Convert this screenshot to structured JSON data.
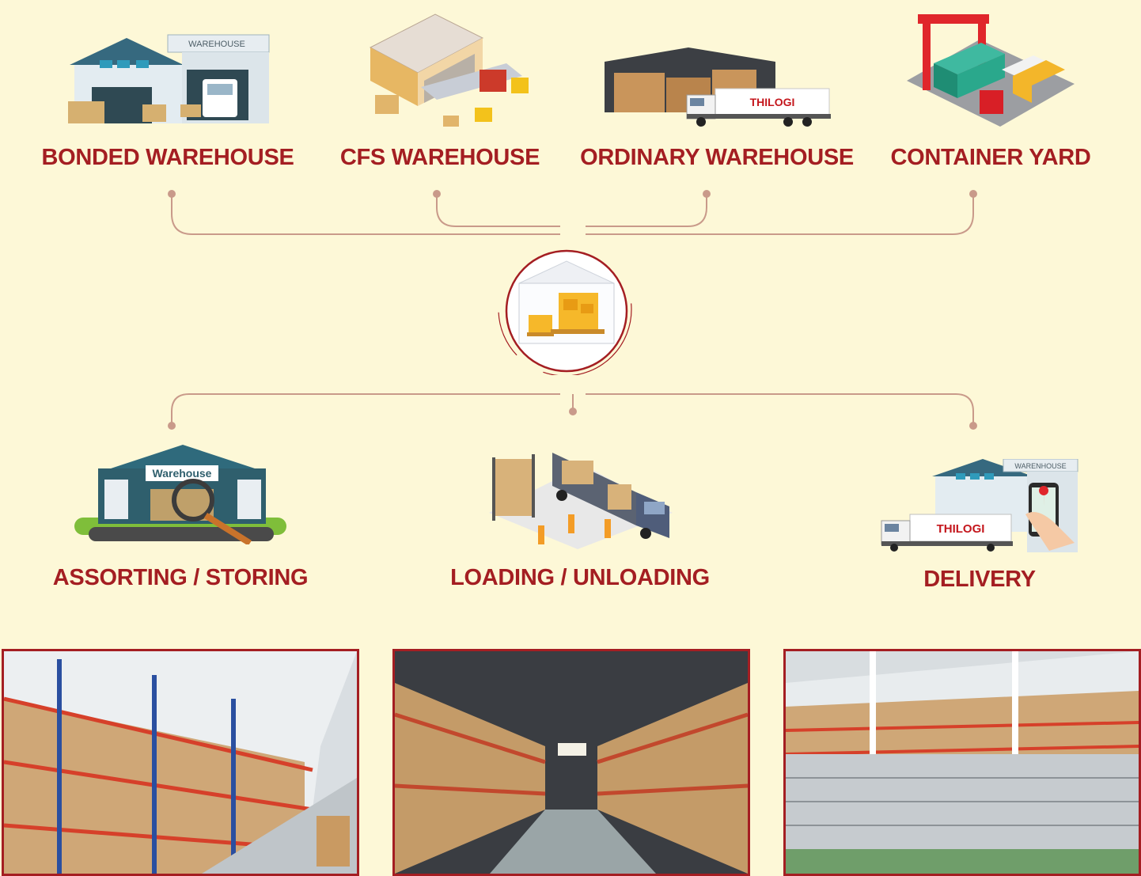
{
  "top_nodes": [
    {
      "label": "BONDED WAREHOUSE",
      "sign": "WAREHOUSE"
    },
    {
      "label": "CFS WAREHOUSE"
    },
    {
      "label": "ORDINARY WAREHOUSE",
      "truck_brand": "THILOGI"
    },
    {
      "label": "CONTAINER YARD"
    }
  ],
  "bottom_nodes": [
    {
      "label": "ASSORTING / STORING",
      "sign": "Warehouse"
    },
    {
      "label": "LOADING / UNLOADING"
    },
    {
      "label": "DELIVERY",
      "sign": "WARENHOUSE",
      "truck_brand": "THILOGI"
    }
  ],
  "colors": {
    "background": "#fdf8d7",
    "accent": "#a41e22",
    "connector": "#c99a8a"
  },
  "icons": {
    "hub": "warehouse-boxes-icon"
  },
  "photos": [
    "warehouse-racks-photo",
    "warehouse-aisle-photo",
    "warehouse-cages-photo"
  ]
}
